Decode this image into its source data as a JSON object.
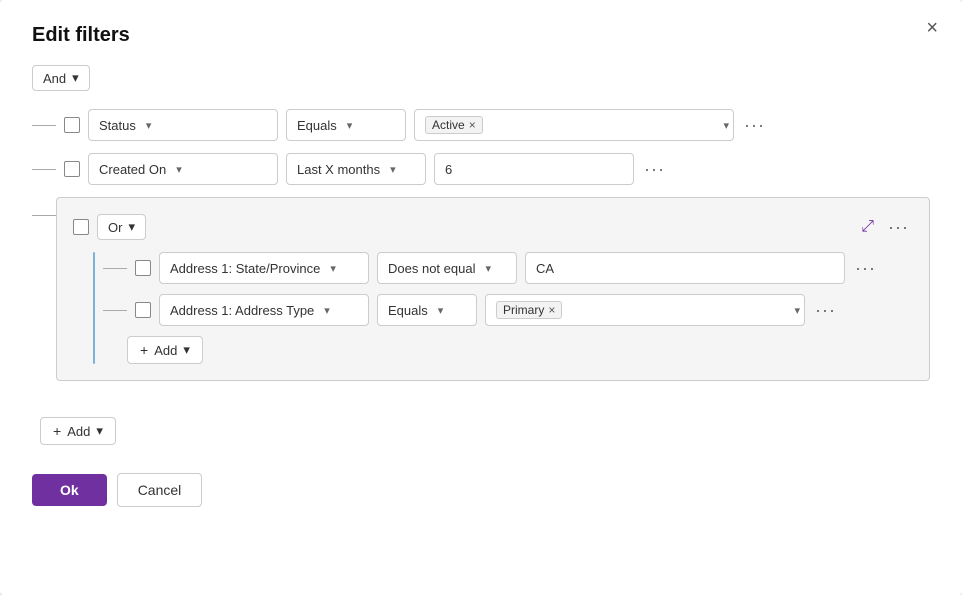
{
  "modal": {
    "title": "Edit filters",
    "close_label": "×"
  },
  "and_group": {
    "label": "And",
    "chevron": "▾"
  },
  "row1": {
    "field_label": "Status",
    "op_label": "Equals",
    "value_tag": "Active",
    "chevron": "▾",
    "more": "···"
  },
  "row2": {
    "field_label": "Created On",
    "op_label": "Last X months",
    "value": "6",
    "chevron": "▾",
    "more": "···"
  },
  "or_group": {
    "label": "Or",
    "chevron": "▾",
    "expand_icon": "⤢",
    "more": "···"
  },
  "or_row1": {
    "field_label": "Address 1: State/Province",
    "op_label": "Does not equal",
    "value": "CA",
    "chevron": "▾",
    "more": "···"
  },
  "or_row2": {
    "field_label": "Address 1: Address Type",
    "op_label": "Equals",
    "value_tag": "Primary",
    "chevron": "▾",
    "more": "···"
  },
  "or_add_btn": {
    "plus": "+",
    "label": "Add",
    "chevron": "▾"
  },
  "main_add_btn": {
    "plus": "+",
    "label": "Add",
    "chevron": "▾"
  },
  "footer": {
    "ok_label": "Ok",
    "cancel_label": "Cancel"
  }
}
